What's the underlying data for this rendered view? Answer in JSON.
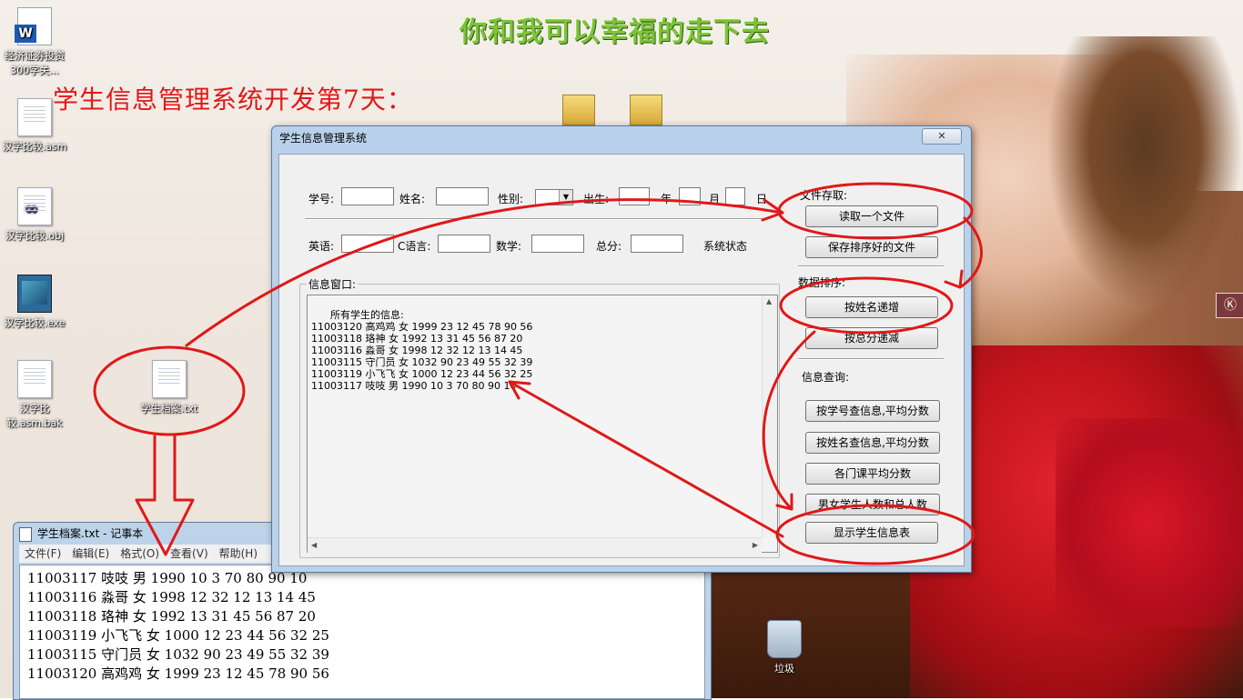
{
  "desktop": {
    "banner": "你和我可以幸福的走下去",
    "headline": "学生信息管理系统开发第7天：",
    "icons": [
      {
        "label": "经济证券投资300字关...",
        "icon": "word-doc-icon"
      },
      {
        "label": "汉字比较.asm",
        "icon": "text-file-icon"
      },
      {
        "label": "汉字比较.obj",
        "icon": "obj-file-icon"
      },
      {
        "label": "汉字比较.exe",
        "icon": "exe-file-icon"
      },
      {
        "label": "汉字比较.asm.bak",
        "icon": "text-file-icon"
      },
      {
        "label": "学生档案.txt",
        "icon": "text-file-icon"
      },
      {
        "label": "垃圾",
        "icon": "recycle-bin-icon"
      }
    ],
    "side_tab": "Ⓚ"
  },
  "dialog": {
    "title": "学生信息管理系统",
    "close": "✕",
    "labels": {
      "student_id": "学号:",
      "name": "姓名:",
      "gender": "性别:",
      "birth": "出生:",
      "year": "年",
      "month": "月",
      "day": "日",
      "english": "英语:",
      "c_lang": "C语言:",
      "math": "数学:",
      "total": "总分:",
      "status": "系统状态"
    },
    "groups": {
      "file_access": "文件存取:",
      "data_sort": "数据排序:",
      "info_query": "信息查询:",
      "info_window": "信息窗口:"
    },
    "buttons": {
      "read_file": "读取一个文件",
      "save_sorted": "保存排序好的文件",
      "sort_by_name": "按姓名递增",
      "sort_by_total": "按总分递减",
      "query_by_id": "按学号查信息,平均分数",
      "query_by_name": "按姓名查信息,平均分数",
      "course_avg": "各门课平均分数",
      "gender_count": "男女学生人数和总人数",
      "show_table": "显示学生信息表"
    },
    "info_text": "所有学生的信息:\n11003120 高鸡鸡 女 1999 23 12 45 78 90 56\n11003118 珞神 女 1992 13 31 45 56 87 20\n11003116 淼哥 女 1998 12 32 12 13 14 45\n11003115 守门员 女 1032 90 23 49 55 32 39\n11003119 小飞飞 女 1000 12 23 44 56 32 25\n11003117 吱吱 男 1990 10 3 70 80 90 10"
  },
  "notepad": {
    "title": "学生档案.txt - 记事本",
    "menu": [
      "文件(F)",
      "编辑(E)",
      "格式(O)",
      "查看(V)",
      "帮助(H)"
    ],
    "content": "11003117 吱吱 男 1990 10 3 70 80 90 10\n11003116 淼哥 女 1998 12 32 12 13 14 45\n11003118 珞神 女 1992 13 31 45 56 87 20\n11003119 小飞飞 女 1000 12 23 44 56 32 25\n11003115 守门员 女 1032 90 23 49 55 32 39\n11003120 高鸡鸡 女 1999 23 12 45 78 90 56"
  },
  "colors": {
    "annotation_red": "#e01818",
    "banner_green": "#7ec23a",
    "dialog_frame": "#b9d1ea"
  }
}
